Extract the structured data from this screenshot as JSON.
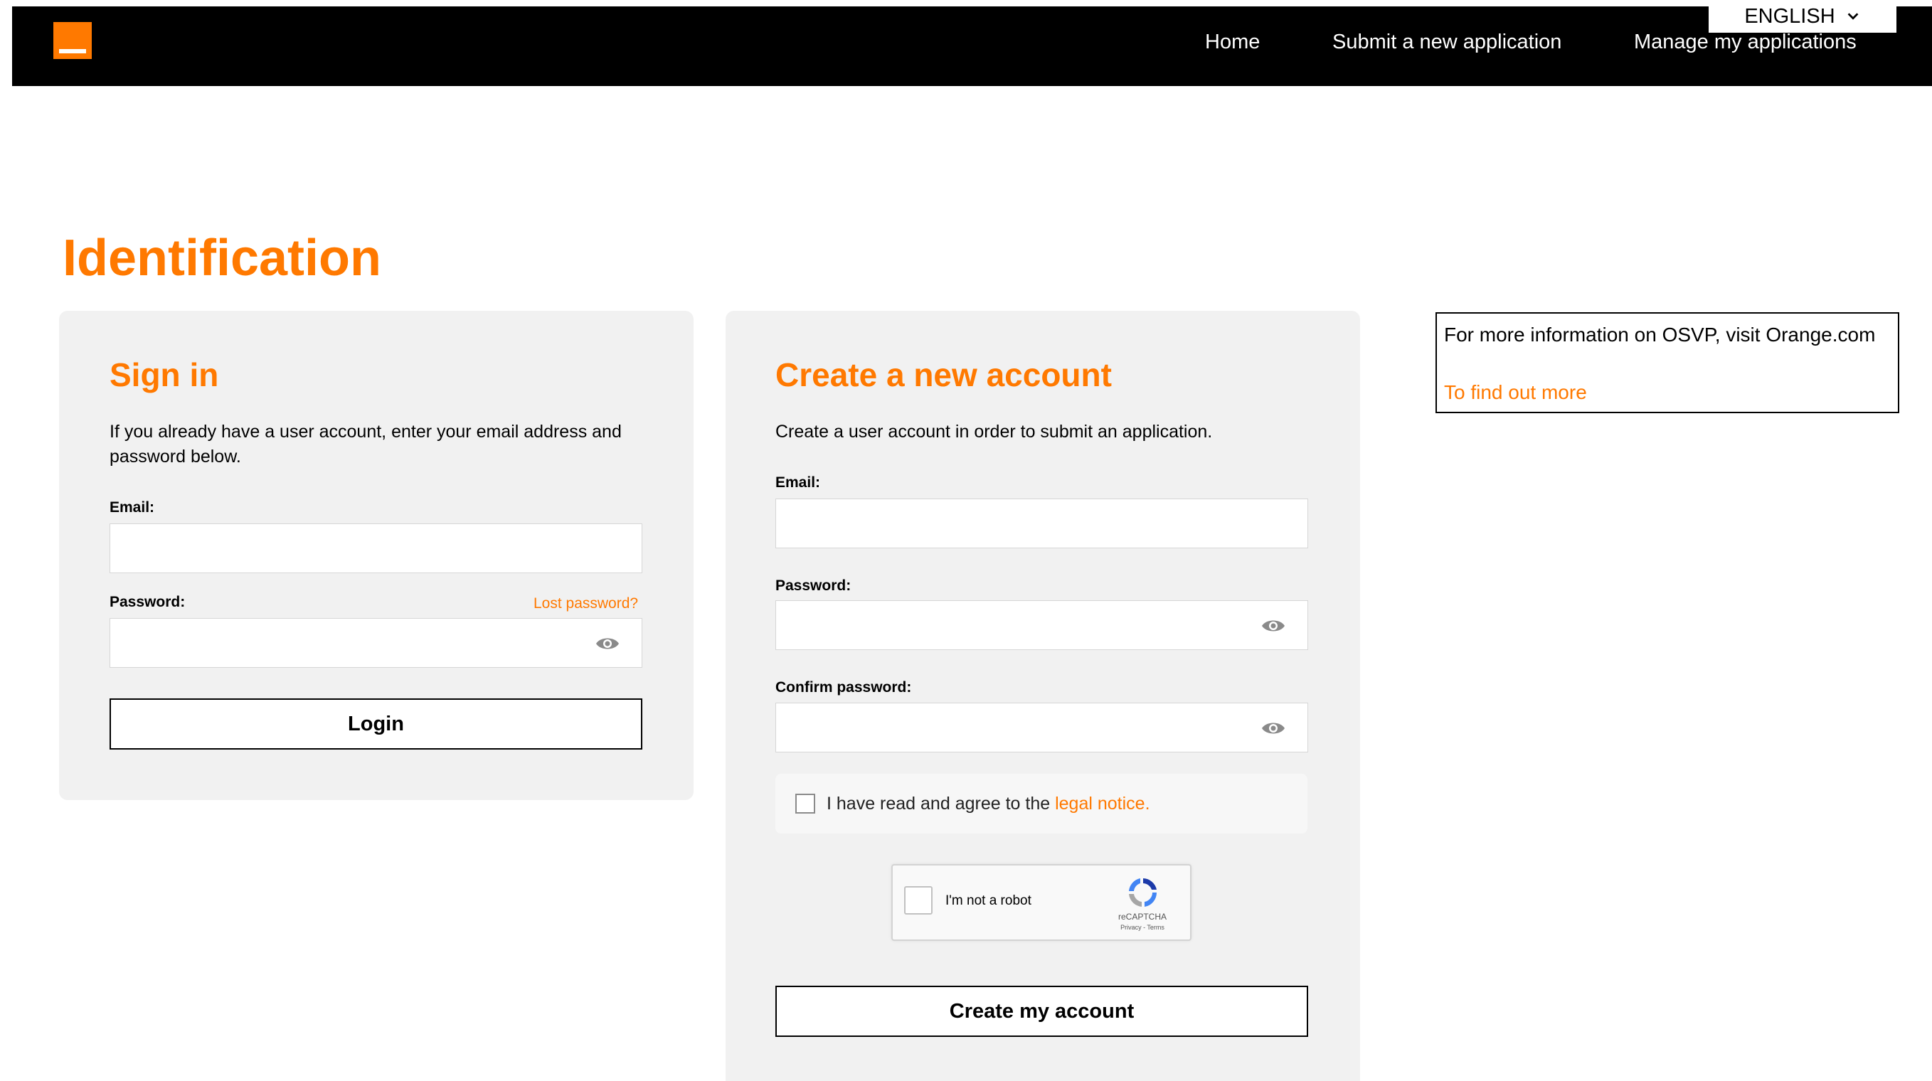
{
  "header": {
    "logo_name": "orange-logo",
    "nav": {
      "home": "Home",
      "submit": "Submit a new application",
      "manage": "Manage my applications"
    },
    "language": "ENGLISH"
  },
  "page": {
    "title": "Identification"
  },
  "signin": {
    "title": "Sign in",
    "description": "If you already have a user account, enter your email address and password below.",
    "email_label": "Email:",
    "email_value": "",
    "password_label": "Password:",
    "password_value": "",
    "lost_password": "Lost password?",
    "login_button": "Login"
  },
  "create": {
    "title": "Create a new account",
    "description": "Create a user account in order to submit an application.",
    "email_label": "Email:",
    "email_value": "",
    "password_label": "Password:",
    "password_value": "",
    "confirm_label": "Confirm password:",
    "confirm_value": "",
    "agree_text": "I have read and agree to the",
    "agree_link": "legal notice",
    "agree_end": ".",
    "agree_checked": false,
    "captcha_label": "I'm not a robot",
    "captcha_brand": "reCAPTCHA",
    "captcha_terms": "Privacy - Terms",
    "submit_button": "Create my account"
  },
  "info": {
    "text": "For more information on OSVP, visit Orange.com",
    "link": "To find out more"
  },
  "colors": {
    "accent": "#ff7900",
    "header_bg": "#000000",
    "card_bg": "#f1f1f1"
  }
}
